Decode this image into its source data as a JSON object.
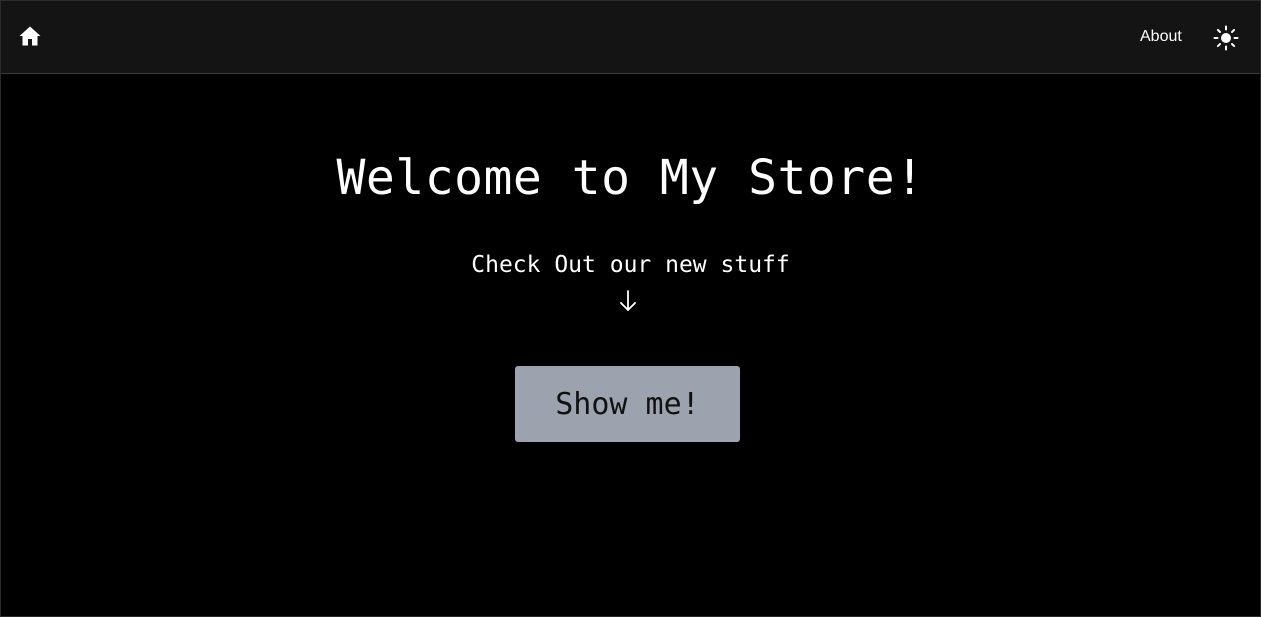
{
  "navbar": {
    "home_icon": "home-icon",
    "about_label": "About",
    "theme_icon": "sun-icon"
  },
  "hero": {
    "title": "Welcome to My Store!",
    "subtitle": "Check Out our new stuff",
    "arrow_icon": "arrow-down-icon",
    "button_label": "Show me!"
  },
  "colors": {
    "background": "#000000",
    "navbar_background": "#141414",
    "text": "#ffffff",
    "button_background": "#9ca3af",
    "button_text": "#111111"
  }
}
